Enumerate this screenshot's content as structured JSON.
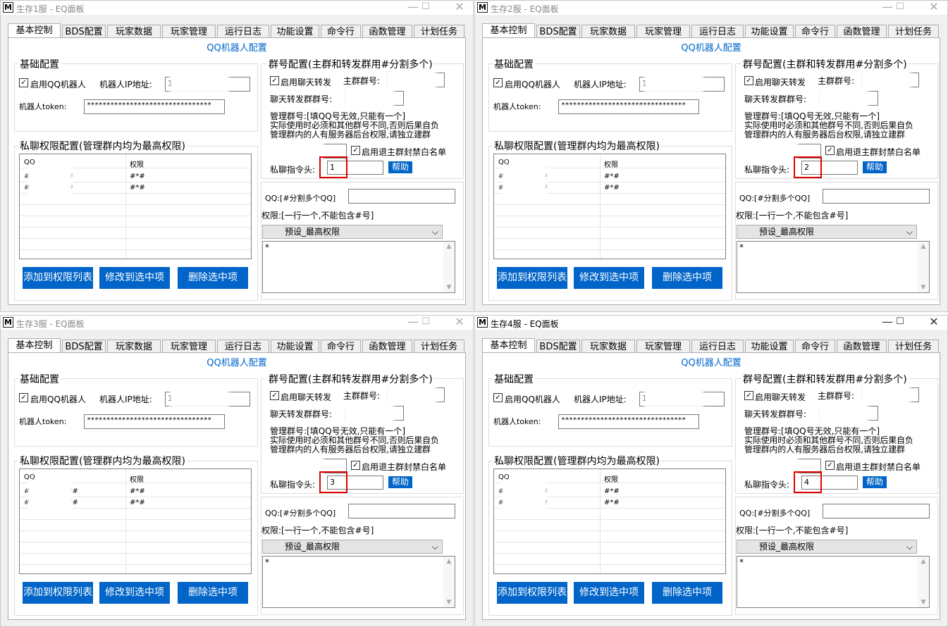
{
  "windows": [
    {
      "title": "生存1服 - EQ面板",
      "active": false,
      "ip_value": "1",
      "qq1_prefix": "#",
      "qq1_suffix": "#",
      "qq2_prefix": "#",
      "qq2_suffix": "#",
      "cmd_prefix": "1"
    },
    {
      "title": "生存2服 - EQ面板",
      "active": false,
      "ip_value": "1",
      "qq1_prefix": "#",
      "qq1_suffix": "#",
      "qq2_prefix": "#",
      "qq2_suffix": "#",
      "cmd_prefix": "2"
    },
    {
      "title": "生存3服 - EQ面板",
      "active": false,
      "ip_value": "11",
      "qq1_prefix": "#",
      "qq1_suffix": "7#",
      "qq2_prefix": "#",
      "qq2_suffix": "7#",
      "cmd_prefix": "3"
    },
    {
      "title": "生存4服 - EQ面板",
      "active": true,
      "ip_value": "1",
      "qq1_prefix": "#",
      "qq1_suffix": "#",
      "qq2_prefix": "#",
      "qq2_suffix": "#",
      "cmd_prefix": "4"
    }
  ],
  "common": {
    "app_icon": "M",
    "tabs": [
      "基本控制",
      "BDS配置",
      "玩家数据",
      "玩家管理",
      "运行日志",
      "功能设置",
      "命令行",
      "函数管理",
      "计划任务"
    ],
    "panel_title": "QQ机器人配置",
    "basic_config": "基础配置",
    "enable_qq_bot": "启用QQ机器人",
    "bot_ip_label": "机器人IP地址:",
    "bot_token_label": "机器人token:",
    "token_value": "********************************",
    "private_perm_title": "私聊权限配置(管理群内均为最高权限)",
    "col_qq": "QQ",
    "col_perm": "权限",
    "perm_value": "#*#",
    "group_config_title": "群号配置(主群和转发群用#分割多个)",
    "enable_chat_forward": "启用聊天转发",
    "main_group_label": "主群群号:",
    "forward_group_label": "聊天转发群群号:",
    "admin_group_line1": "管理群号:[填QQ号无效,只能有一个]",
    "admin_group_line2": "实际使用时必须和其他群号不同,否则后果自负",
    "admin_group_line3": "管理群内的人有服务器后台权限,请独立建群",
    "enable_quit_ban": "启用退主群封禁白名单",
    "cmd_prefix_label": "私聊指令头:",
    "help_button": "帮助",
    "qq_input_label": "QQ:[#分割多个QQ]",
    "perm_input_label": "权限:[一行一个,不能包含#号]",
    "preset_option": "预设_最高权限",
    "textarea_value": "*",
    "add_button": "添加到权限列表",
    "modify_button": "修改到选中项",
    "delete_button": "删除选中项",
    "minimize_glyph": "—",
    "maximize_glyph": "☐",
    "close_glyph": "✕",
    "checkbox_glyph": "✓",
    "dropdown_glyph": "⌵",
    "scroll_up_glyph": "▲",
    "scroll_down_glyph": "▼"
  }
}
